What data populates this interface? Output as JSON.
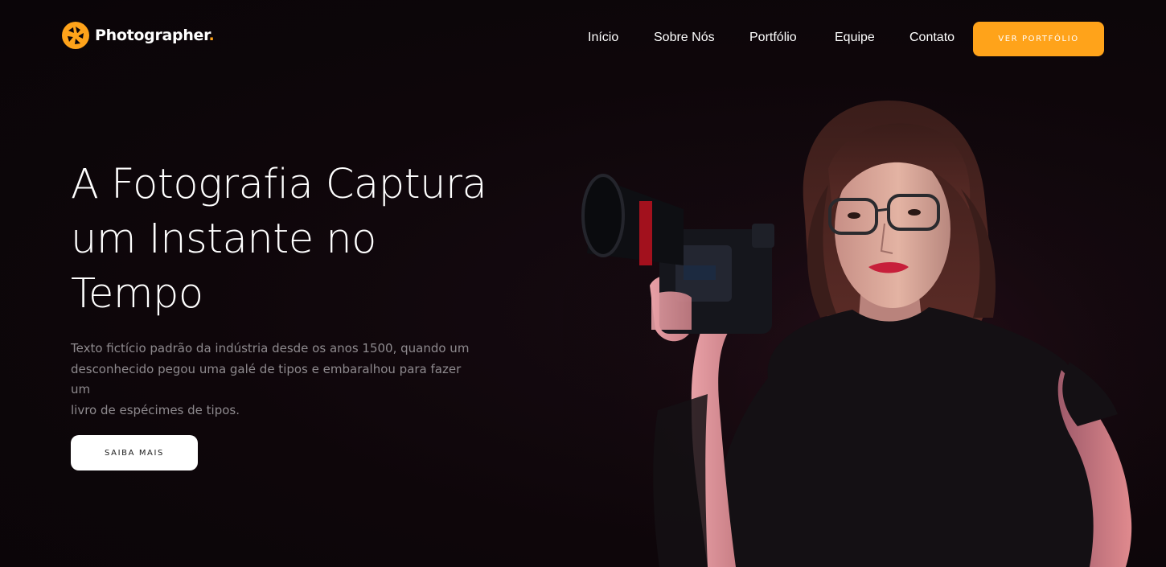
{
  "brand": {
    "name": "Photographer",
    "dot": ".",
    "accent_color": "#ffa31a",
    "logo_icon": "camera-aperture-icon"
  },
  "nav": {
    "items": [
      {
        "label": "Início"
      },
      {
        "label": "Sobre Nós"
      },
      {
        "label": "Portfólio"
      },
      {
        "label": "Equipe"
      },
      {
        "label": "Contato"
      }
    ],
    "cta_label": "VER PORTFÓLIO"
  },
  "hero": {
    "title_lines": [
      "A Fotografia Captura",
      "um Instante no",
      "Tempo"
    ],
    "description_lines": [
      "Texto fictício padrão da indústria desde os anos 1500, quando um",
      "desconhecido pegou uma galé de tipos e embaralhou para fazer um",
      "livro de espécimes de tipos."
    ],
    "button_label": "SAIBA MAIS",
    "image_subject": "woman-holding-camera-photo"
  },
  "colors": {
    "background": "#0d0609",
    "text_primary": "#ffffff",
    "text_muted": "#8e8a8e",
    "accent": "#ffa31a"
  }
}
